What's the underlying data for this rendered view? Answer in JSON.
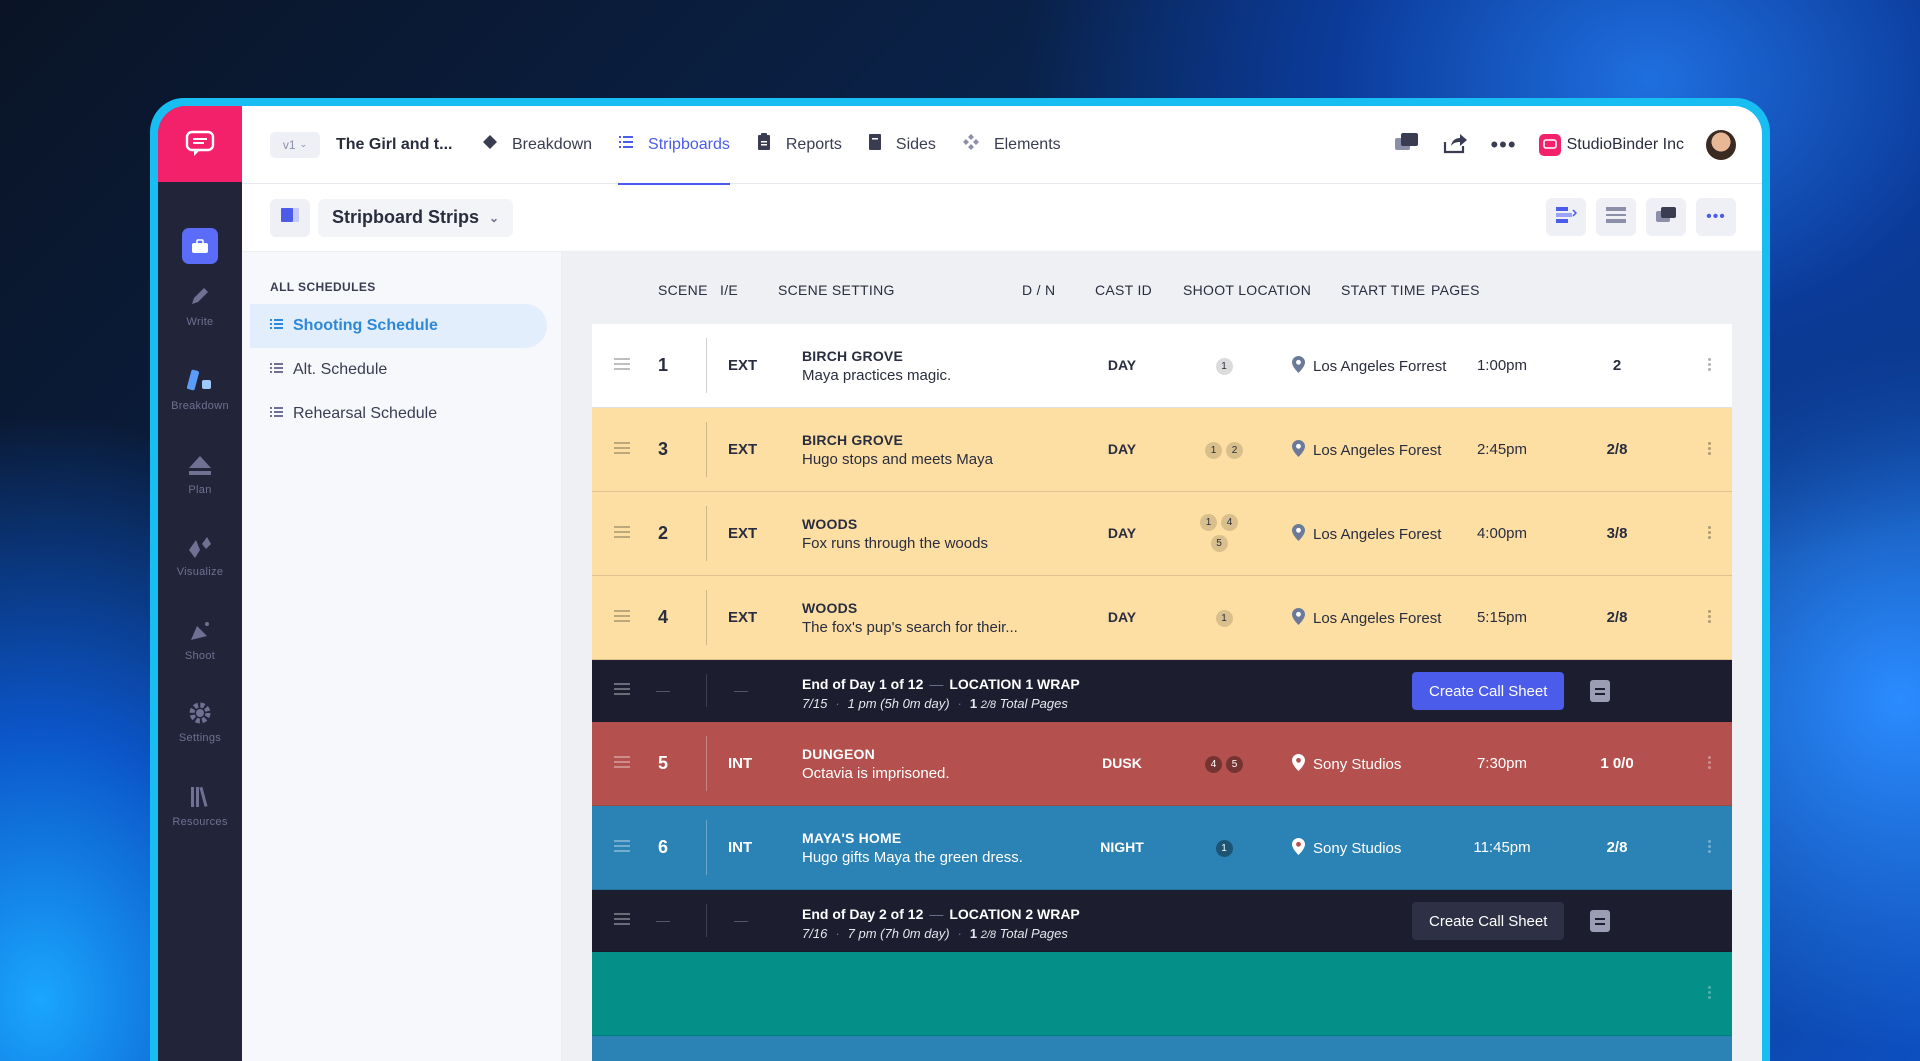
{
  "project": {
    "version": "v1",
    "title": "The Girl and t..."
  },
  "nav_tabs": [
    {
      "label": "Breakdown",
      "icon": "diamond-icon"
    },
    {
      "label": "Stripboards",
      "icon": "list-icon",
      "active": true
    },
    {
      "label": "Reports",
      "icon": "clipboard-icon"
    },
    {
      "label": "Sides",
      "icon": "book-icon"
    },
    {
      "label": "Elements",
      "icon": "elements-icon"
    }
  ],
  "org": {
    "name": "StudioBinder Inc"
  },
  "rail": [
    {
      "label": "Write"
    },
    {
      "label": "Breakdown"
    },
    {
      "label": "Plan"
    },
    {
      "label": "Visualize"
    },
    {
      "label": "Shoot"
    },
    {
      "label": "Settings"
    },
    {
      "label": "Resources"
    }
  ],
  "board": {
    "selector_label": "Stripboard Strips"
  },
  "sidebar": {
    "heading": "ALL SCHEDULES",
    "items": [
      {
        "label": "Shooting Schedule",
        "active": true
      },
      {
        "label": "Alt. Schedule"
      },
      {
        "label": "Rehearsal Schedule"
      }
    ]
  },
  "columns": {
    "scene": "SCENE",
    "ie": "I/E",
    "setting": "SCENE SETTING",
    "dn": "D / N",
    "cast": "CAST ID",
    "location": "SHOOT LOCATION",
    "start": "START TIME",
    "pages": "PAGES"
  },
  "strips": [
    {
      "scene": "1",
      "ie": "EXT",
      "title": "BIRCH GROVE",
      "desc": "Maya practices magic.",
      "dn": "DAY",
      "cast": [
        "1"
      ],
      "location": "Los Angeles Forrest",
      "time": "1:00pm",
      "pages": "2",
      "color": "#ffffff"
    },
    {
      "scene": "3",
      "ie": "EXT",
      "title": "BIRCH GROVE",
      "desc": "Hugo stops and meets Maya",
      "dn": "DAY",
      "cast": [
        "1",
        "2"
      ],
      "location": "Los Angeles Forest",
      "time": "2:45pm",
      "pages": "2/8",
      "color": "#fddfa4"
    },
    {
      "scene": "2",
      "ie": "EXT",
      "title": "WOODS",
      "desc": "Fox runs through the woods",
      "dn": "DAY",
      "cast": [
        "1",
        "4",
        "5"
      ],
      "location": "Los Angeles Forest",
      "time": "4:00pm",
      "pages": "3/8",
      "color": "#fddfa4"
    },
    {
      "scene": "4",
      "ie": "EXT",
      "title": "WOODS",
      "desc": "The fox's pup's search for their...",
      "dn": "DAY",
      "cast": [
        "1"
      ],
      "location": "Los Angeles Forest",
      "time": "5:15pm",
      "pages": "2/8",
      "color": "#fddfa4"
    },
    {
      "scene": "5",
      "ie": "INT",
      "title": "DUNGEON",
      "desc": "Octavia is imprisoned.",
      "dn": "DUSK",
      "cast": [
        "4",
        "5"
      ],
      "location": "Sony Studios",
      "time": "7:30pm",
      "pages": "1 0/0",
      "color": "#b4504d"
    },
    {
      "scene": "6",
      "ie": "INT",
      "title": "MAYA'S HOME",
      "desc": "Hugo gifts Maya the green dress.",
      "dn": "NIGHT",
      "cast": [
        "1"
      ],
      "location": "Sony Studios",
      "time": "11:45pm",
      "pages": "2/8",
      "color": "#2b82b4"
    }
  ],
  "day_breaks": [
    {
      "title": "End of Day 1 of 12",
      "wrap": "LOCATION 1 WRAP",
      "date": "7/15",
      "hours": "1 pm (5h 0m day)",
      "pages_whole": "1",
      "pages_frac": "2/8",
      "pages_suffix": "Total Pages",
      "button": "Create Call Sheet"
    },
    {
      "title": "End of Day 2 of 12",
      "wrap": "LOCATION 2 WRAP",
      "date": "7/16",
      "hours": "7 pm (7h 0m day)",
      "pages_whole": "1",
      "pages_frac": "2/8",
      "pages_suffix": "Total Pages",
      "button": "Create Call Sheet"
    }
  ],
  "colors": {
    "accent": "#4b5bea",
    "brand": "#f2216a",
    "rail": "#22243a",
    "teal_strip": "#058f89"
  }
}
